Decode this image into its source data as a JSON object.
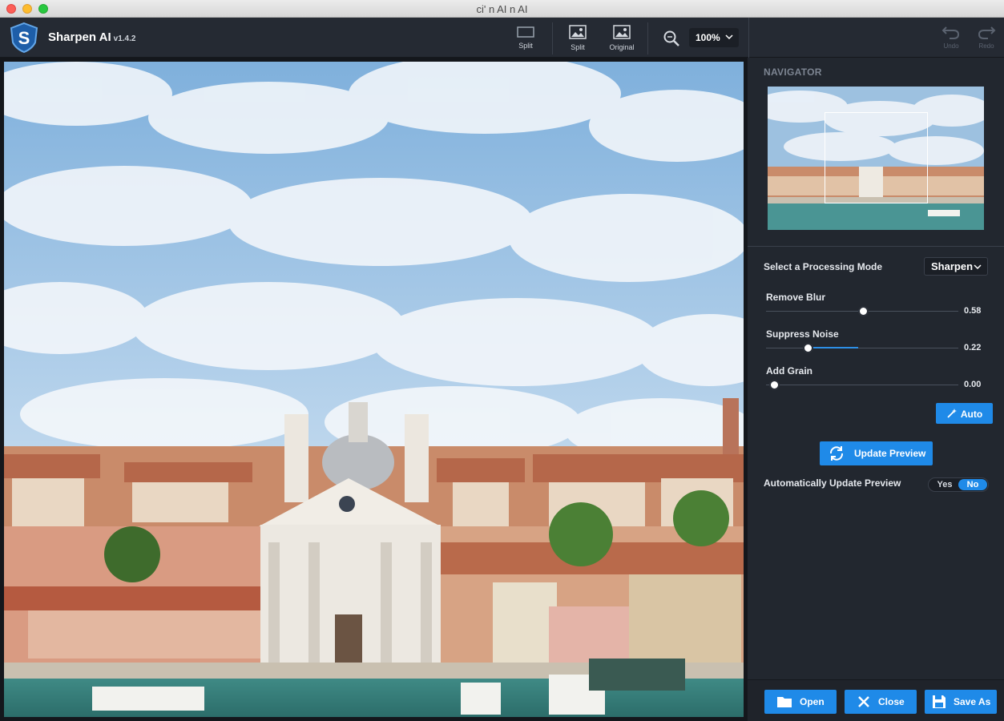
{
  "window": {
    "title": "ci' n AI n AI"
  },
  "app": {
    "name": "Sharpen AI",
    "version": "v1.4.2"
  },
  "toolbar": {
    "split_top_label": "Split",
    "split_label": "Split",
    "original_label": "Original",
    "zoom_level": "100%",
    "undo_label": "Undo",
    "redo_label": "Redo"
  },
  "navigator": {
    "title": "NAVIGATOR"
  },
  "processing": {
    "mode_label": "Select a Processing Mode",
    "mode_value": "Sharpen",
    "sliders": [
      {
        "label": "Remove Blur",
        "value": "0.58",
        "level": 0.58
      },
      {
        "label": "Suppress Noise",
        "value": "0.22",
        "level": 0.22
      },
      {
        "label": "Add Grain",
        "value": "0.00",
        "level": 0.0
      }
    ],
    "auto_label": "Auto",
    "update_label": "Update Preview",
    "auto_update_label": "Automatically Update Preview",
    "yes_label": "Yes",
    "no_label": "No",
    "auto_update_selected": "No"
  },
  "actions": {
    "open_label": "Open",
    "close_label": "Close",
    "save_label": "Save As"
  },
  "colors": {
    "accent": "#1f8ae8",
    "panel": "#22272f",
    "toolbar": "#252a33"
  }
}
